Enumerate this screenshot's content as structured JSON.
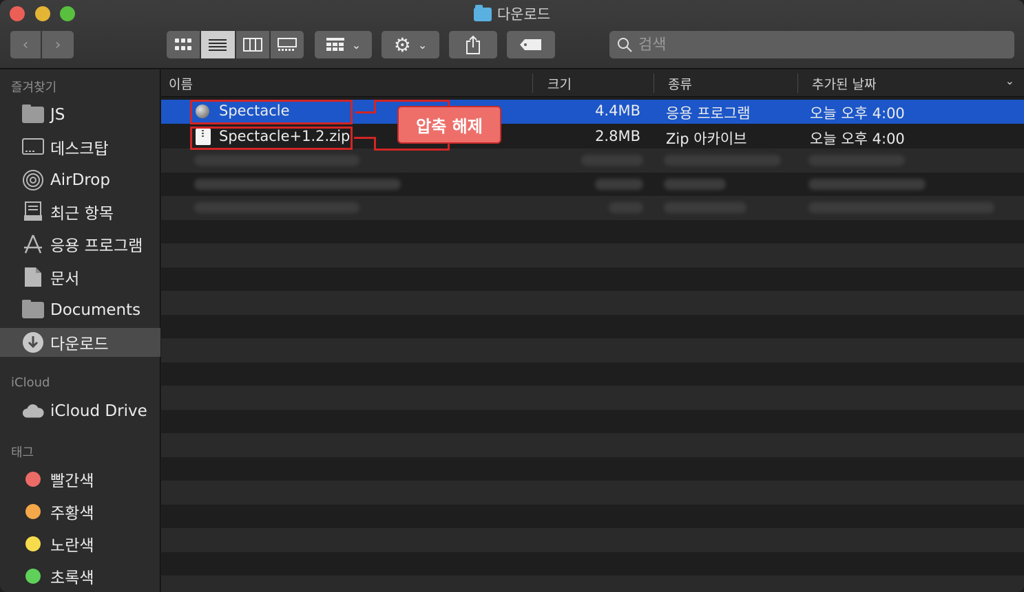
{
  "window": {
    "title": "다운로드"
  },
  "search": {
    "placeholder": "검색"
  },
  "sidebar": {
    "favorites_header": "즐겨찾기",
    "favorites": [
      {
        "label": "JS",
        "icon": "folder-icon"
      },
      {
        "label": "데스크탑",
        "icon": "desktop-icon"
      },
      {
        "label": "AirDrop",
        "icon": "airdrop-icon"
      },
      {
        "label": "최근 항목",
        "icon": "recents-icon"
      },
      {
        "label": "응용 프로그램",
        "icon": "applications-icon"
      },
      {
        "label": "문서",
        "icon": "document-icon"
      },
      {
        "label": "Documents",
        "icon": "folder-icon"
      },
      {
        "label": "다운로드",
        "icon": "download-icon",
        "active": true
      }
    ],
    "icloud_header": "iCloud",
    "icloud": [
      {
        "label": "iCloud Drive",
        "icon": "cloud-icon"
      }
    ],
    "tags_header": "태그",
    "tags": [
      {
        "label": "빨간색",
        "color": "#ec6b66"
      },
      {
        "label": "주황색",
        "color": "#f4a84a"
      },
      {
        "label": "노란색",
        "color": "#f6dc4c"
      },
      {
        "label": "초록색",
        "color": "#5fd05a"
      }
    ]
  },
  "columns": {
    "name": "이름",
    "size": "크기",
    "kind": "종류",
    "date": "추가된 날짜"
  },
  "files": [
    {
      "name": "Spectacle",
      "size": "4.4MB",
      "kind": "응용 프로그램",
      "date": "오늘 오후 4:00",
      "icon": "app-icon",
      "selected": true
    },
    {
      "name": "Spectacle+1.2.zip",
      "size": "2.8MB",
      "kind": "Zip 아카이브",
      "date": "오늘 오후 4:00",
      "icon": "zip-icon"
    }
  ],
  "annotation": {
    "label": "압축 해제"
  }
}
